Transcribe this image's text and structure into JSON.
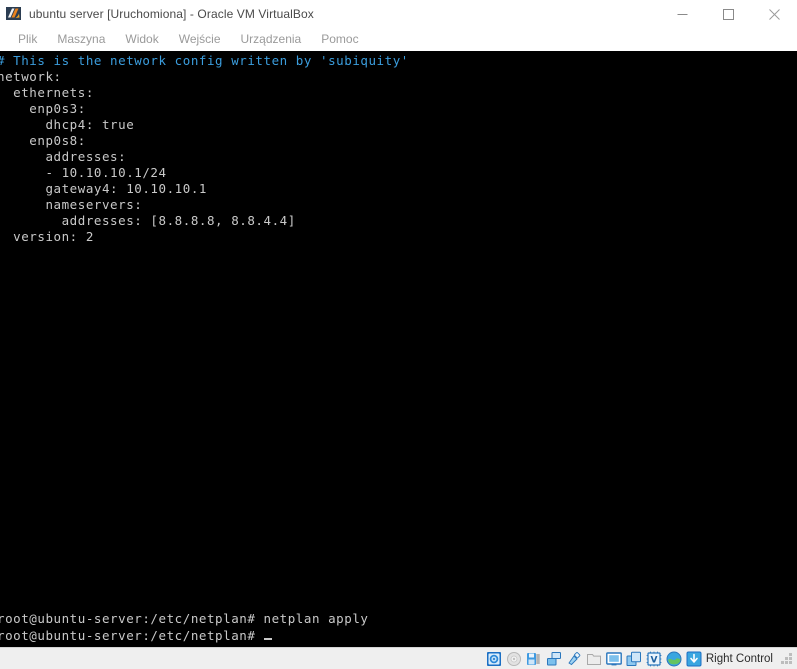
{
  "window": {
    "title": "ubuntu server [Uruchomiona] - Oracle VM VirtualBox",
    "icon": "virtualbox-logo-icon",
    "controls": {
      "minimize": "minimize-icon",
      "maximize": "maximize-icon",
      "close": "close-icon"
    }
  },
  "menubar": {
    "items": [
      {
        "label": "Plik"
      },
      {
        "label": "Maszyna"
      },
      {
        "label": "Widok"
      },
      {
        "label": "Wejście"
      },
      {
        "label": "Urządzenia"
      },
      {
        "label": "Pomoc"
      }
    ]
  },
  "terminal": {
    "colors": {
      "background": "#000000",
      "foreground": "#c9c9c9",
      "comment": "#3b9ddd"
    },
    "lines": [
      {
        "text": "# This is the network config written by 'subiquity'",
        "color": "comment"
      },
      {
        "text": "network:",
        "color": "normal"
      },
      {
        "text": "  ethernets:",
        "color": "normal"
      },
      {
        "text": "    enp0s3:",
        "color": "normal"
      },
      {
        "text": "      dhcp4: true",
        "color": "normal"
      },
      {
        "text": "    enp0s8:",
        "color": "normal"
      },
      {
        "text": "      addresses:",
        "color": "normal"
      },
      {
        "text": "      - 10.10.10.1/24",
        "color": "normal"
      },
      {
        "text": "      gateway4: 10.10.10.1",
        "color": "normal"
      },
      {
        "text": "      nameservers:",
        "color": "normal"
      },
      {
        "text": "        addresses: [8.8.8.8, 8.8.4.4]",
        "color": "normal"
      },
      {
        "text": "  version: 2",
        "color": "normal"
      }
    ],
    "prompt_lines": [
      {
        "prompt": "root@ubuntu-server:/etc/netplan# ",
        "command": "netplan apply"
      },
      {
        "prompt": "root@ubuntu-server:/etc/netplan# ",
        "command": ""
      }
    ]
  },
  "statusbar": {
    "icons": [
      {
        "name": "hard-disk-icon"
      },
      {
        "name": "optical-disc-icon"
      },
      {
        "name": "floppy-disk-icon"
      },
      {
        "name": "network-adapter-icon"
      },
      {
        "name": "usb-icon"
      },
      {
        "name": "shared-folders-icon"
      },
      {
        "name": "display-icon"
      },
      {
        "name": "recording-icon"
      },
      {
        "name": "virtualization-icon"
      },
      {
        "name": "remote-desktop-icon"
      },
      {
        "name": "host-key-icon"
      }
    ],
    "host_key_label": "Right Control",
    "resize_grip": "resize-grip-icon"
  }
}
